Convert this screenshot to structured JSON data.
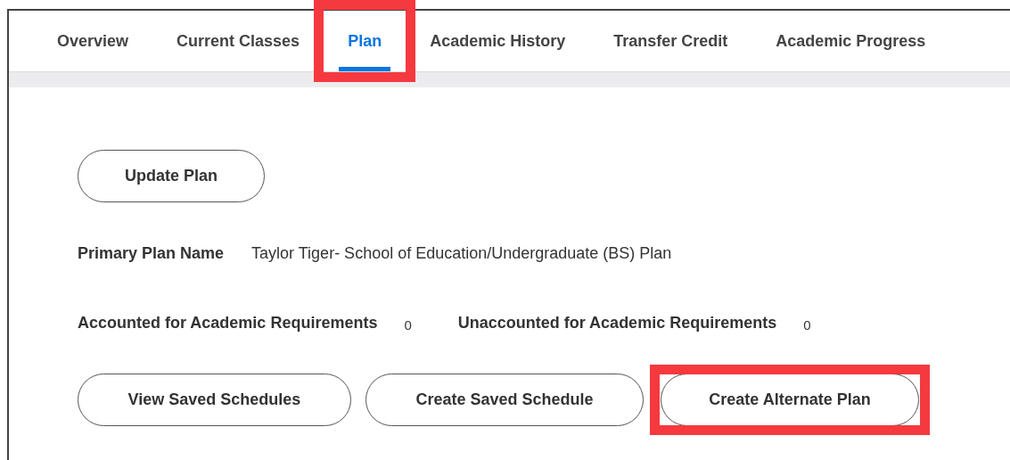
{
  "tabs": [
    {
      "label": "Overview",
      "selected": false,
      "highlighted": false
    },
    {
      "label": "Current Classes",
      "selected": false,
      "highlighted": false
    },
    {
      "label": "Plan",
      "selected": true,
      "highlighted": true
    },
    {
      "label": "Academic History",
      "selected": false,
      "highlighted": false
    },
    {
      "label": "Transfer Credit",
      "selected": false,
      "highlighted": false
    },
    {
      "label": "Academic Progress",
      "selected": false,
      "highlighted": false
    }
  ],
  "update_button": {
    "label": "Update Plan",
    "highlighted": false
  },
  "primary_plan": {
    "label": "Primary Plan Name",
    "value": "Taylor Tiger- School of Education/Undergraduate (BS) Plan"
  },
  "requirements": [
    {
      "label": "Accounted for Academic Requirements",
      "value": "0"
    },
    {
      "label": "Unaccounted for Academic Requirements",
      "value": "0"
    }
  ],
  "buttons": [
    {
      "label": "View Saved Schedules",
      "highlighted": false
    },
    {
      "label": "Create Saved Schedule",
      "highlighted": false
    },
    {
      "label": "Create Alternate Plan",
      "highlighted": true
    }
  ]
}
